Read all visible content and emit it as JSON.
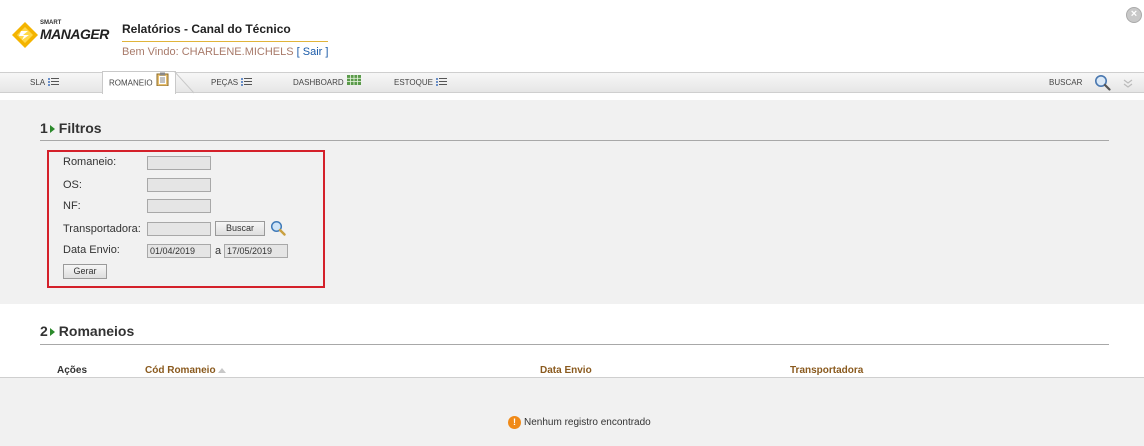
{
  "header": {
    "logo_small": "SMART",
    "logo_big": "MANAGER",
    "title": "Relatórios - Canal do Técnico",
    "welcome_prefix": "Bem Vindo: ",
    "user_name": "CHARLENE.MICHELS",
    "logout_label": " [ Sair ]",
    "close_glyph": "×"
  },
  "tabs": [
    {
      "label": "SLA",
      "icon": "list-icon"
    },
    {
      "label": "ROMANEIO",
      "icon": "clipboard-icon"
    },
    {
      "label": "PEÇAS",
      "icon": "list-icon"
    },
    {
      "label": "DASHBOARD",
      "icon": "grid-icon"
    },
    {
      "label": "ESTOQUE",
      "icon": "list-icon"
    }
  ],
  "active_tab": "ROMANEIO",
  "search": {
    "label": "BUSCAR",
    "icon": "magnifier-icon"
  },
  "filters": {
    "section_number": "1",
    "section_title": "Filtros",
    "romaneio_label": "Romaneio:",
    "os_label": "OS:",
    "nf_label": "NF:",
    "transportadora_label": "Transportadora:",
    "buscar_button": "Buscar",
    "data_envio_label": "Data Envio:",
    "date_from": "01/04/2019",
    "date_sep": "a",
    "date_to": "17/05/2019",
    "gerar_button": "Gerar",
    "romaneio_value": "",
    "os_value": "",
    "nf_value": "",
    "transportadora_value": ""
  },
  "romaneios": {
    "section_number": "2",
    "section_title": "Romaneios",
    "columns": [
      "Ações",
      "Cód Romaneio",
      "Data Envio",
      "Transportadora"
    ],
    "empty_icon": "!",
    "empty_message": "Nenhum registro encontrado"
  },
  "colors": {
    "accent_red": "#d4202a",
    "link_blue": "#1a5aa8",
    "column_brown": "#8a5a1e",
    "arrow_green": "#2c8a2c"
  }
}
